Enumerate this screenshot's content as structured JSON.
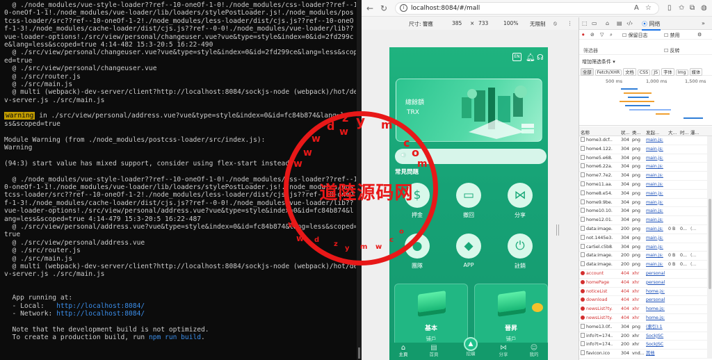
{
  "terminal": {
    "lines": [
      {
        "t": "  @ ./node_modules/vue-style-loader??ref--10-oneOf-1-0!./node_modules/css-loader??ref--1"
      },
      {
        "t": "0-oneOf-1-1!./node_modules/vue-loader/lib/loaders/stylePostLoader.js!./node_modules/pos"
      },
      {
        "t": "tcss-loader/src??ref--10-oneOf-1-2!./node_modules/less-loader/dist/cjs.js??ref--10-oneO"
      },
      {
        "t": "f-1-3!./node_modules/cache-loader/dist/cjs.js??ref--0-0!./node_modules/vue-loader/lib??"
      },
      {
        "t": "vue-loader-options!./src/view/personal/changeuser.vue?vue&type=style&index=0&id=2fd299c"
      },
      {
        "t": "e&lang=less&scoped=true 4:14-482 15:3-20:5 16:22-490"
      },
      {
        "t": "  @ ./src/view/personal/changeuser.vue?vue&type=style&index=0&id=2fd299ce&lang=less&scop"
      },
      {
        "t": "ed=true"
      },
      {
        "t": "  @ ./src/view/personal/changeuser.vue"
      },
      {
        "t": "  @ ./src/router.js"
      },
      {
        "t": "  @ ./src/main.js"
      },
      {
        "t": "  @ multi (webpack)-dev-server/client?http://localhost:8084/sockjs-node (webpack)/hot/de"
      },
      {
        "t": "v-server.js ./src/main.js"
      },
      {
        "t": ""
      },
      {
        "t": "",
        "warn": "warning",
        "rest": " in ./src/view/personal/address.vue?vue&type=style&index=0&id=fc84b874&lang=le"
      },
      {
        "t": "ss&scoped=true"
      },
      {
        "t": ""
      },
      {
        "t": "Module Warning (from ./node_modules/postcss-loader/src/index.js):"
      },
      {
        "t": "Warning"
      },
      {
        "t": ""
      },
      {
        "t": "(94:3) start value has mixed support, consider using flex-start instead"
      },
      {
        "t": ""
      },
      {
        "t": "  @ ./node_modules/vue-style-loader??ref--10-oneOf-1-0!./node_modules/css-loader??ref--1"
      },
      {
        "t": "0-oneOf-1-1!./node_modules/vue-loader/lib/loaders/stylePostLoader.js!./node_modules/pos"
      },
      {
        "t": "tcss-loader/src??ref--10-oneOf-1-2!./node_modules/less-loader/dist/cjs.js??ref--10-oneO"
      },
      {
        "t": "f-1-3!./node_modules/cache-loader/dist/cjs.js??ref--0-0!./node_modules/vue-loader/lib??"
      },
      {
        "t": "vue-loader-options!./src/view/personal/address.vue?vue&type=style&index=0&id=fc84b874&l"
      },
      {
        "t": "ang=less&scoped=true 4:14-479 15:3-20:5 16:22-487"
      },
      {
        "t": "  @ ./src/view/personal/address.vue?vue&type=style&index=0&id=fc84b874&lang=less&scoped="
      },
      {
        "t": "true"
      },
      {
        "t": "  @ ./src/view/personal/address.vue"
      },
      {
        "t": "  @ ./src/router.js"
      },
      {
        "t": "  @ ./src/main.js"
      },
      {
        "t": "  @ multi (webpack)-dev-server/client?http://localhost:8084/sockjs-node (webpack)/hot/de"
      },
      {
        "t": "v-server.js ./src/main.js"
      },
      {
        "t": ""
      },
      {
        "t": ""
      },
      {
        "t": "  App running at:"
      },
      {
        "t": "  - Local:   ",
        "url": "http://localhost:8084/"
      },
      {
        "t": "  - Network: ",
        "url": "http://localhost:8084/"
      },
      {
        "t": ""
      },
      {
        "t": "  Note that the development build is not optimized."
      },
      {
        "t": "  To create a production build, run ",
        "cmd": "npm run build",
        "after": "."
      }
    ]
  },
  "browser": {
    "url": "localhost:8084/#/mall",
    "zoom_icon": "A",
    "device": {
      "size_label": "尺寸: 響應",
      "width": "385",
      "height": "733",
      "zoom": "100%",
      "throttle": "无限制"
    },
    "phone": {
      "lang_badge": "EN",
      "hero": {
        "title": "總餘額",
        "currency": "TRX"
      },
      "faq_title": "常見問題",
      "grid": [
        {
          "label": "押金",
          "icon": "$"
        },
        {
          "label": "撤回",
          "icon": "▭"
        },
        {
          "label": "分享",
          "icon": "⋈"
        },
        {
          "label": "團隊",
          "icon": "●"
        },
        {
          "label": "APP",
          "icon": "◆"
        },
        {
          "label": "註銷",
          "icon": "⏻"
        }
      ],
      "cards": [
        {
          "title": "基本",
          "sub": "铺戶"
        },
        {
          "title": "晉昇",
          "sub": "铺戶"
        }
      ],
      "tabs": [
        {
          "label": "主頁",
          "icon": "⌂"
        },
        {
          "label": "首頁",
          "icon": "▤"
        },
        {
          "label": "挖礦",
          "icon": "▲"
        },
        {
          "label": "分享",
          "icon": "⋈"
        },
        {
          "label": "我的",
          "icon": "☺"
        }
      ]
    },
    "devtools": {
      "panel_tab": "网络",
      "preserve_log": "保留日志",
      "disable_cache": "禁用",
      "filter_placeholder": "筛选器",
      "invert": "反转",
      "more_filters": "增加筛选条件 ▾",
      "chips": [
        "全部",
        "Fetch/XHR",
        "文档",
        "CSS",
        "JS",
        "字体",
        "Img",
        "媒体"
      ],
      "timeline": [
        "500 ms",
        "1,000 ms",
        "1,500 ms"
      ],
      "columns": [
        "名称",
        "状...",
        "类...",
        "发起...",
        "大...",
        "时...",
        "瀑..."
      ],
      "rows": [
        {
          "name": "home3.dcf...",
          "status": "304",
          "type": "png",
          "init": "main.js:",
          "size": "",
          "time": "",
          "wf": "",
          "err": false
        },
        {
          "name": "home4.122...",
          "status": "304",
          "type": "png",
          "init": "main.js:",
          "size": "",
          "time": "",
          "wf": "",
          "err": false
        },
        {
          "name": "home5.e68...",
          "status": "304",
          "type": "png",
          "init": "main.js:",
          "size": "",
          "time": "",
          "wf": "",
          "err": false
        },
        {
          "name": "home6.22a...",
          "status": "304",
          "type": "png",
          "init": "main.js:",
          "size": "",
          "time": "",
          "wf": "",
          "err": false
        },
        {
          "name": "home7.7e2...",
          "status": "304",
          "type": "png",
          "init": "main.js:",
          "size": "",
          "time": "",
          "wf": "",
          "err": false
        },
        {
          "name": "home11.aa...",
          "status": "304",
          "type": "png",
          "init": "main.js:",
          "size": "",
          "time": "",
          "wf": "",
          "err": false
        },
        {
          "name": "home8.e54...",
          "status": "304",
          "type": "png",
          "init": "main.js:",
          "size": "",
          "time": "",
          "wf": "",
          "err": false
        },
        {
          "name": "home9.9be...",
          "status": "304",
          "type": "png",
          "init": "main.js:",
          "size": "",
          "time": "",
          "wf": "",
          "err": false
        },
        {
          "name": "home10.10...",
          "status": "304",
          "type": "png",
          "init": "main.js:",
          "size": "",
          "time": "",
          "wf": "",
          "err": false
        },
        {
          "name": "home12.01...",
          "status": "304",
          "type": "png",
          "init": "main.js:",
          "size": "",
          "time": "",
          "wf": "",
          "err": false
        },
        {
          "name": "data:image...",
          "status": "200",
          "type": "png",
          "init": "main.js:",
          "size": "0 B",
          "time": "0...",
          "wf": "(...",
          "err": false
        },
        {
          "name": "not.1445e3...",
          "status": "304",
          "type": "png",
          "init": "main.js:",
          "size": "",
          "time": "",
          "wf": "",
          "err": false
        },
        {
          "name": "carSel.c5b8...",
          "status": "304",
          "type": "png",
          "init": "main.js:",
          "size": "",
          "time": "",
          "wf": "",
          "err": false
        },
        {
          "name": "data:image...",
          "status": "200",
          "type": "png",
          "init": "main.js:",
          "size": "0 B",
          "time": "0...",
          "wf": "(...",
          "err": false
        },
        {
          "name": "data:image...",
          "status": "200",
          "type": "png",
          "init": "main.js:",
          "size": "0 B",
          "time": "0...",
          "wf": "(...",
          "err": false
        },
        {
          "name": "account",
          "status": "404",
          "type": "xhr",
          "init": "personal",
          "size": "",
          "time": "",
          "wf": "",
          "err": true
        },
        {
          "name": "homePage",
          "status": "404",
          "type": "xhr",
          "init": "personal",
          "size": "",
          "time": "",
          "wf": "",
          "err": true
        },
        {
          "name": "noticeList",
          "status": "404",
          "type": "xhr",
          "init": "home.js:",
          "size": "",
          "time": "",
          "wf": "",
          "err": true
        },
        {
          "name": "download",
          "status": "404",
          "type": "xhr",
          "init": "personal",
          "size": "",
          "time": "",
          "wf": "",
          "err": true
        },
        {
          "name": "newsList?ty...",
          "status": "404",
          "type": "xhr",
          "init": "home.js:",
          "size": "",
          "time": "",
          "wf": "",
          "err": true
        },
        {
          "name": "newsList?ty...",
          "status": "404",
          "type": "xhr",
          "init": "home.js:",
          "size": "",
          "time": "",
          "wf": "",
          "err": true
        },
        {
          "name": "home13.0f...",
          "status": "304",
          "type": "png",
          "init": "(索引):1",
          "size": "",
          "time": "",
          "wf": "",
          "err": false
        },
        {
          "name": "info?t=174...",
          "status": "200",
          "type": "xhr",
          "init": "SockJSC",
          "size": "",
          "time": "",
          "wf": "",
          "err": false
        },
        {
          "name": "info?t=174...",
          "status": "200",
          "type": "xhr",
          "init": "SockJSC",
          "size": "",
          "time": "",
          "wf": "",
          "err": false
        },
        {
          "name": "favicon.ico",
          "status": "304",
          "type": "vnd...",
          "init": "其他",
          "size": "",
          "time": "",
          "wf": "",
          "err": false
        }
      ]
    }
  },
  "watermark": {
    "text": "道陸源码网",
    "letters": [
      "d",
      "z",
      "y",
      "m",
      "w",
      "c",
      "o",
      "m",
      "w",
      "w",
      "w",
      "w",
      "w",
      "d",
      "z",
      "y",
      "m",
      "w",
      "c",
      "o"
    ]
  },
  "colors": {
    "phone_green": "#17a276",
    "error_red": "#d32f2f",
    "link_blue": "#3b8eea",
    "warning_yellow": "#c19c00",
    "watermark_red": "#e81818"
  }
}
